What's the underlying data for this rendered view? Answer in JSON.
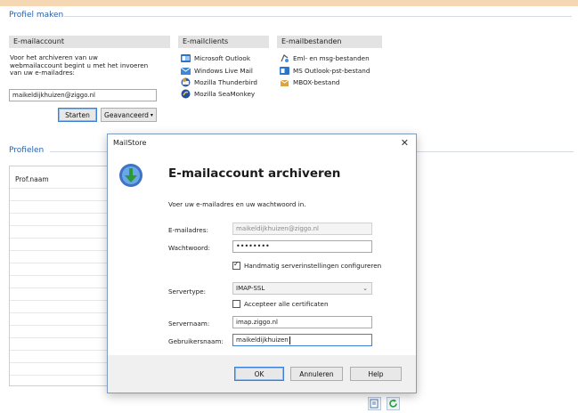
{
  "profiel_maken": {
    "title": "Profiel maken"
  },
  "emailaccount": {
    "header": "E-mailaccount",
    "description_lines": [
      "Voor het archiveren van uw",
      "webmailaccount begint u met het invoeren",
      "van uw e-mailadres:"
    ],
    "email_value": "maikeldijkhuizen@ziggo.nl",
    "start_label": "Starten",
    "advanced_label": "Geavanceerd"
  },
  "emailclients": {
    "header": "E-mailclients",
    "items": [
      {
        "label": "Microsoft Outlook",
        "icon": "outlook-icon"
      },
      {
        "label": "Windows Live Mail",
        "icon": "windows-live-mail-icon"
      },
      {
        "label": "Mozilla Thunderbird",
        "icon": "thunderbird-icon"
      },
      {
        "label": "Mozilla SeaMonkey",
        "icon": "seamonkey-icon"
      }
    ]
  },
  "emailfiles": {
    "header": "E-mailbestanden",
    "items": [
      {
        "label": "Eml- en msg-bestanden",
        "icon": "eml-msg-icon"
      },
      {
        "label": "MS Outlook-pst-bestand",
        "icon": "pst-file-icon"
      },
      {
        "label": "MBOX-bestand",
        "icon": "mbox-file-icon"
      }
    ]
  },
  "profielen": {
    "title": "Profielen",
    "column": "Prof.naam"
  },
  "dialog": {
    "window_title": "MailStore",
    "heading": "E-mailaccount archiveren",
    "intro": "Voer uw e-mailadres en uw wachtwoord in.",
    "email_label": "E-mailadres:",
    "email_value": "maikeldijkhuizen@ziggo.nl",
    "password_label": "Wachtwoord:",
    "password_value": "••••••••",
    "manual_label": "Handmatig serverinstellingen configureren",
    "servertype_label": "Servertype:",
    "servertype_value": "IMAP-SSL",
    "accept_cert_label": "Accepteer alle certificaten",
    "servername_label": "Servernaam:",
    "servername_value": "imap.ziggo.nl",
    "username_label": "Gebruikersnaam:",
    "username_value": "maikeldijkhuizen",
    "ok_label": "OK",
    "cancel_label": "Annuleren",
    "help_label": "Help"
  },
  "colors": {
    "accent_blue": "#2b5fa8",
    "primary_border": "#3c7fd6",
    "header_gray": "#e3e3e3"
  }
}
